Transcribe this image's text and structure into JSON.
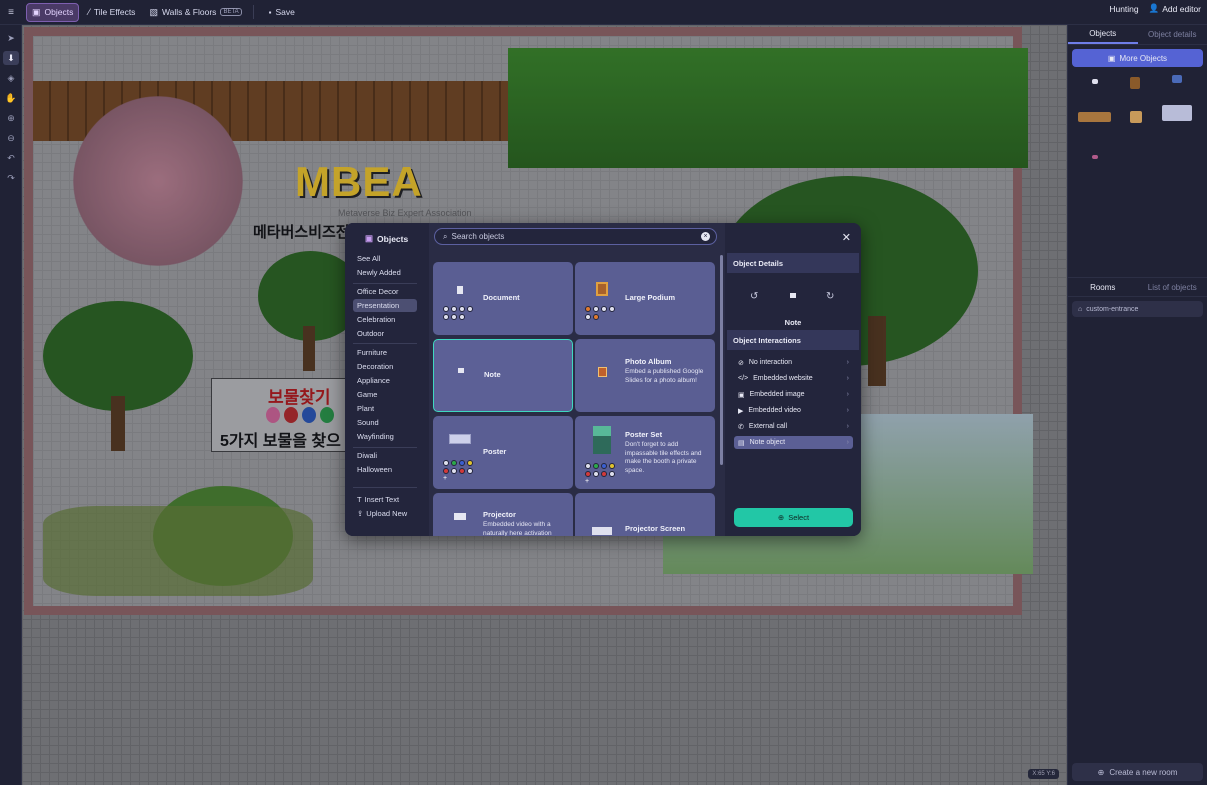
{
  "topbar": {
    "menu_icon": "hamburger-icon",
    "tabs": [
      {
        "label": "Objects",
        "icon": "objects-icon",
        "active": true
      },
      {
        "label": "Tile Effects",
        "icon": "wand-icon"
      },
      {
        "label": "Walls & Floors",
        "icon": "walls-icon",
        "badge": "BETA"
      }
    ],
    "save_label": "Save",
    "hunting_label": "Hunting",
    "add_editor_label": "Add editor"
  },
  "canvas": {
    "sign_title": "보물찾기",
    "sign_text": "5가지 보물을 찾으",
    "logo_text": "MBEA",
    "logo_sub": "Metaverse Biz Expert Association",
    "logo_kr": "메타버스비즈전문가협회(MBEA)",
    "zoom_readout": "X:65  Y:6"
  },
  "right_panel": {
    "tabs": [
      "Objects",
      "Object details"
    ],
    "more_objects_label": "More Objects",
    "rooms_tabs": [
      "Rooms",
      "List of objects"
    ],
    "room_name": "custom-entrance",
    "create_room_label": "Create a new room"
  },
  "modal": {
    "title": "Objects",
    "search_placeholder": "Search objects",
    "categories_group1": [
      "See All",
      "Newly Added"
    ],
    "categories_group2": [
      "Office Decor",
      "Presentation",
      "Celebration",
      "Outdoor"
    ],
    "categories_group3": [
      "Furniture",
      "Decoration",
      "Appliance",
      "Game",
      "Plant",
      "Sound",
      "Wayfinding"
    ],
    "categories_group4": [
      "Diwali",
      "Halloween"
    ],
    "active_category": "Presentation",
    "insert_text_label": "Insert Text",
    "upload_new_label": "Upload New",
    "cards": [
      {
        "name": "Document",
        "desc": "",
        "dots": [
          "#dfe0ee",
          "#dfe0ee",
          "#dfe0ee",
          "#dfe0ee",
          "#dfe0ee",
          "#dfe0ee",
          "#dfe0ee"
        ]
      },
      {
        "name": "Large Podium",
        "desc": "",
        "dots": [
          "#e07a2e",
          "#dfe0ee",
          "#dfe0ee",
          "#dfe0ee",
          "#dfe0ee",
          "#e07a2e"
        ]
      },
      {
        "name": "Note",
        "desc": "",
        "dots": []
      },
      {
        "name": "Photo Album",
        "desc": "Embed a published Google Slides for a photo album!",
        "dots": []
      },
      {
        "name": "Poster",
        "desc": "",
        "dots": [
          "#dfe0ee",
          "#2ca84a",
          "#3a5fd0",
          "#d23a3a",
          "#e0c22e",
          "#dfe0ee",
          "#d23a3a",
          "#dfe0ee",
          "+"
        ]
      },
      {
        "name": "Poster Set",
        "desc": "Don't forget to add impassable tile effects and make the booth a private space.",
        "dots": [
          "#dfe0ee",
          "#2ca84a",
          "#3a5fd0",
          "#d23a3a",
          "#e0c22e",
          "#dfe0ee",
          "#d23a3a",
          "#dfe0ee",
          "+"
        ]
      },
      {
        "name": "Projector",
        "desc": "Embedded video with a naturally here activation",
        "dots": []
      },
      {
        "name": "Projector Screen",
        "desc": "",
        "dots": []
      }
    ],
    "details": {
      "title": "Object Details",
      "object_name": "Note",
      "interactions_title": "Object Interactions",
      "interactions": [
        {
          "label": "No interaction",
          "icon": "no-interaction-icon"
        },
        {
          "label": "Embedded website",
          "icon": "code-icon"
        },
        {
          "label": "Embedded image",
          "icon": "image-icon"
        },
        {
          "label": "Embedded video",
          "icon": "video-icon"
        },
        {
          "label": "External call",
          "icon": "phone-icon"
        },
        {
          "label": "Note object",
          "icon": "note-icon",
          "active": true
        }
      ],
      "select_label": "Select"
    }
  }
}
